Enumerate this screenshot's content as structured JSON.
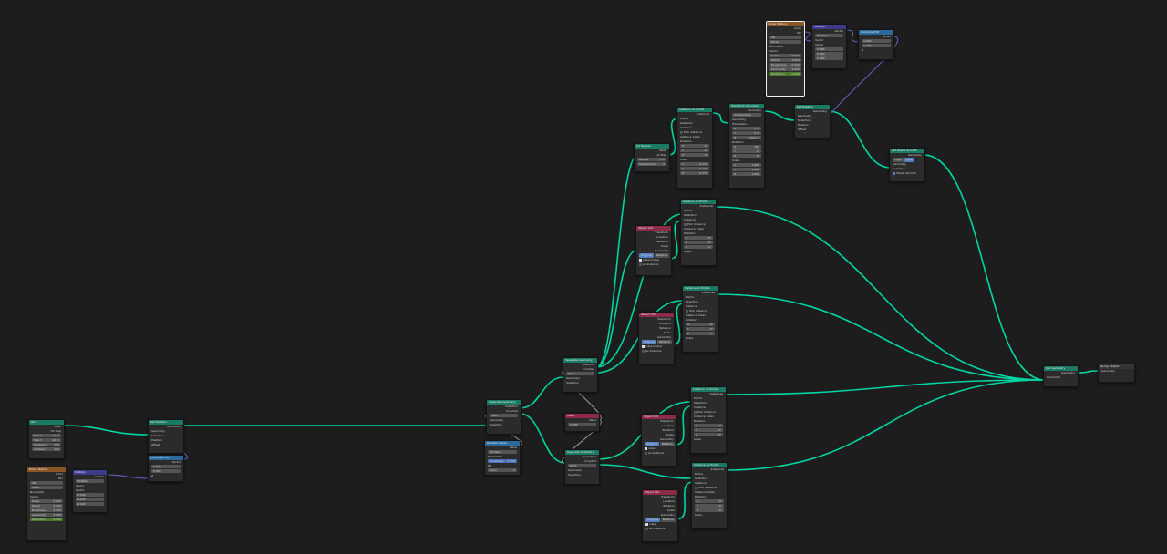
{
  "colors": {
    "background": "#1d1d1d",
    "geometry_link": "#00d6a3",
    "vector_link": "#6363c7",
    "float_link": "#a1a1a1"
  },
  "nodes": {
    "grid": {
      "title": "Grid",
      "mesh": "Mesh",
      "uvmap": "UV Map",
      "size_x": "Size X",
      "size_y": "Size Y",
      "verts_x": "Vertices X",
      "verts_y": "Vertices Y",
      "vx": "10 m",
      "vy": "10 m",
      "nx": "100",
      "ny": "100"
    },
    "noise1": {
      "title": "Noise Texture",
      "color": "Color",
      "fac": "Fac",
      "dim": "3D",
      "type": "Perlin",
      "norm": "Normalize",
      "vector": "Vector",
      "scale": "Scale",
      "detail": "Detail",
      "rough": "Roughness",
      "lac": "Lacunarity",
      "distort": "Distortion",
      "scale_v": "5.000",
      "detail_v": "2.000",
      "rough_v": "0.500",
      "lac_v": "2.000",
      "distort_v": "0.000"
    },
    "multiply1": {
      "title": "Multiply",
      "op": "Multiply",
      "vector": "Vector",
      "x": "0.100",
      "y": "0.100",
      "z": "0.100"
    },
    "setpos1": {
      "title": "Set Position",
      "geometry": "Geometry",
      "selection": "Selection",
      "position": "Position",
      "offset": "Offset"
    },
    "combine1": {
      "title": "Combine XYZ",
      "vector": "Vector",
      "x": "0.000",
      "y": "0.000",
      "z": "Z"
    },
    "separate1": {
      "title": "Separate Geometry",
      "selection": "Selection",
      "inverted": "Inverted",
      "domain": "Point",
      "geometry": "Geometry"
    },
    "randomval": {
      "title": "Random Value",
      "value": "Value",
      "type": "Boolean",
      "prob": "Probability",
      "prob_v": "0.500",
      "id": "ID",
      "seed": "Seed",
      "seed_v": "0"
    },
    "separate2": {
      "title": "Separate Geometry",
      "selection": "Selection",
      "inverted": "Inverted",
      "domain": "Point",
      "geometry": "Geometry"
    },
    "separate3": {
      "title": "Separate Geometry",
      "selection": "Selection",
      "inverted": "Inverted",
      "domain": "Point",
      "geometry": "Geometry"
    },
    "value": {
      "title": "Value",
      "value": "Value",
      "v": "0.300"
    },
    "uvsphere": {
      "title": "UV Sphere",
      "mesh": "Mesh",
      "uvmap": "UV Map",
      "radius": "Radius",
      "subdiv": "Subdivisions",
      "radius_v": "1 m",
      "subdiv_v": "2"
    },
    "objinfo1": {
      "title": "Object Info",
      "transform": "Transform",
      "location": "Location",
      "rotation": "Rotation",
      "scale": "Scale",
      "geometry": "Geometry",
      "orig": "Original",
      "rel": "Relative",
      "obj": "cube.hollow",
      "inst": "As Instance"
    },
    "objinfo2": {
      "title": "Object Info",
      "transform": "Transform",
      "location": "Location",
      "rotation": "Rotation",
      "scale": "Scale",
      "geometry": "Geometry",
      "orig": "Original",
      "rel": "Relative",
      "obj": "cube.hollow",
      "inst": "As Instance"
    },
    "objinfo3": {
      "title": "Object Info",
      "transform": "Transform",
      "location": "Location",
      "rotation": "Rotation",
      "scale": "Scale",
      "geometry": "Geometry",
      "orig": "Original",
      "rel": "Relative",
      "obj": "cube",
      "inst": "As Instance"
    },
    "objinfo4": {
      "title": "Object Info",
      "transform": "Transform",
      "location": "Location",
      "rotation": "Rotation",
      "scale": "Scale",
      "geometry": "Geometry",
      "orig": "Original",
      "rel": "Relative",
      "obj": "cube",
      "inst": "As Instance"
    },
    "iop1": {
      "title": "Instance on Points",
      "instances": "Instances",
      "points": "Points",
      "selection": "Selection",
      "instance": "Instance",
      "pick": "Pick Instance",
      "index": "Instance Index",
      "rotation": "Rotation",
      "scale": "Scale",
      "x": "X",
      "y": "Y",
      "z": "Z",
      "rx": "0°",
      "ry": "0°",
      "rz": "0°",
      "sx": "0.170",
      "sy": "0.170",
      "sz": "0.170"
    },
    "iop2": {
      "title": "Instance on Points",
      "instances": "Instances",
      "points": "Points",
      "selection": "Selection",
      "instance": "Instance",
      "pick": "Pick Instance",
      "index": "Instance Index",
      "rotation": "Rotation",
      "scale": "Scale",
      "x": "X",
      "y": "Y",
      "z": "Z",
      "rx": "0°",
      "ry": "0°",
      "rz": "0°"
    },
    "iop3": {
      "title": "Instance on Points",
      "instances": "Instances",
      "points": "Points",
      "selection": "Selection",
      "instance": "Instance",
      "pick": "Pick Instance",
      "index": "Instance Index",
      "rotation": "Rotation",
      "scale": "Scale",
      "x": "X",
      "y": "Y",
      "z": "Z",
      "rx": "0°",
      "ry": "0°",
      "rz": "0°"
    },
    "iop4": {
      "title": "Instance on Points",
      "instances": "Instances",
      "points": "Points",
      "selection": "Selection",
      "instance": "Instance",
      "pick": "Pick Instance",
      "index": "Instance Index",
      "rotation": "Rotation",
      "scale": "Scale",
      "x": "X",
      "y": "Y",
      "z": "Z",
      "rx": "0°",
      "ry": "0°",
      "rz": "0°"
    },
    "iop5": {
      "title": "Instance on Points",
      "instances": "Instances",
      "points": "Points",
      "selection": "Selection",
      "instance": "Instance",
      "pick": "Pick Instance",
      "index": "Instance Index",
      "rotation": "Rotation",
      "scale": "Scale",
      "x": "X",
      "y": "Y",
      "z": "Z",
      "rx": "0°",
      "ry": "0°",
      "rz": "0°"
    },
    "transform": {
      "title": "Transform Geometry",
      "geometry": "Geometry",
      "mode": "Components",
      "translation": "Translation",
      "rotation": "Rotation",
      "scale": "Scale",
      "tx": "0 m",
      "ty": "0 m",
      "tz": "0.602 m",
      "rx": "90°",
      "ry": "0°",
      "rz": "0°",
      "sx": "1.000",
      "sy": "1.000",
      "sz": "1.000"
    },
    "noise2": {
      "title": "Noise Texture",
      "color": "Color",
      "fac": "Fac",
      "dim": "3D",
      "type": "Perlin",
      "norm": "Normalize",
      "vector": "Vector",
      "scale": "Scale",
      "detail": "Detail",
      "rough": "Roughness",
      "lac": "Lacunarity",
      "distort": "Distortion",
      "scale_v": "5.000",
      "detail_v": "2.000",
      "rough_v": "0.500",
      "lac_v": "2.000",
      "distort_v": "0.000"
    },
    "multiply2": {
      "title": "Multiply",
      "op": "Multiply",
      "vector": "Vector",
      "x": "0.100",
      "y": "0.100",
      "z": "0.100"
    },
    "combine2": {
      "title": "Combine XYZ",
      "vector": "Vector",
      "x": "0.000",
      "y": "0.000",
      "z": "Z"
    },
    "setpos2": {
      "title": "Set Position",
      "geometry": "Geometry",
      "selection": "Selection",
      "position": "Position",
      "offset": "Offset"
    },
    "shadesmooth": {
      "title": "Set Shade Smooth",
      "geometry": "Geometry",
      "edge": "Edge",
      "face": "Face",
      "selection": "Selection",
      "smooth": "Shade Smooth"
    },
    "join": {
      "title": "Join Geometry",
      "geometry": "Geometry"
    },
    "output": {
      "title": "Group Output",
      "geometry": "Geometry"
    }
  }
}
